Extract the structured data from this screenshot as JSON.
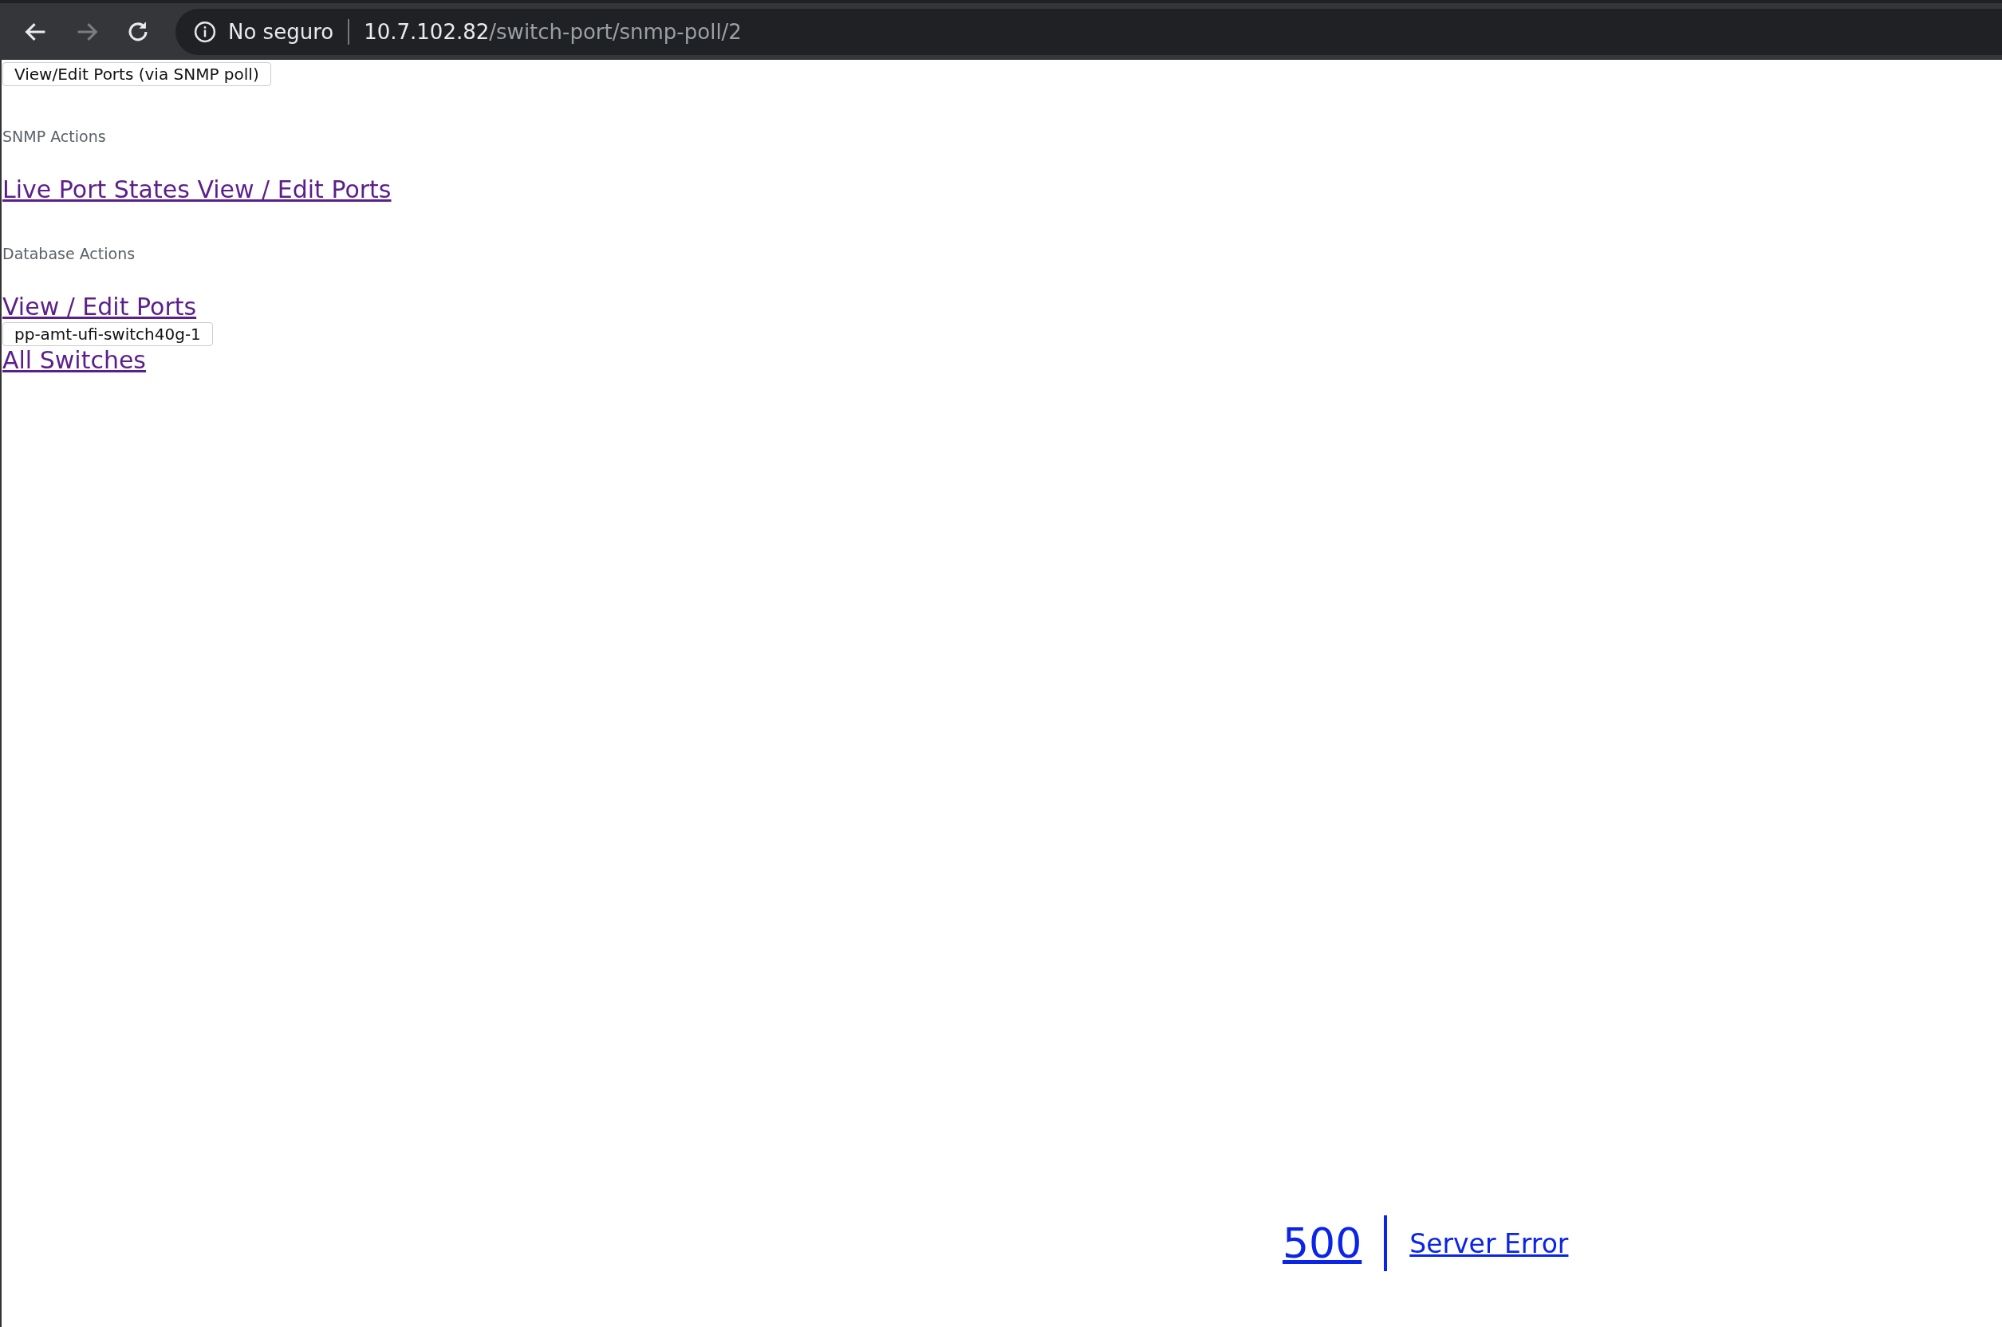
{
  "browser": {
    "back_disabled": false,
    "forward_disabled": true,
    "security_label": "No seguro",
    "url_host": "10.7.102.82",
    "url_path": "/switch-port/snmp-poll/2"
  },
  "page": {
    "top_button": "View/Edit Ports (via SNMP poll)",
    "sections": [
      {
        "heading": "SNMP Actions",
        "link": "Live Port States View / Edit Ports"
      },
      {
        "heading": "Database Actions",
        "link": "View / Edit Ports"
      }
    ],
    "switch_button": "pp-amt-ufi-switch40g-1",
    "all_switches_link": "All Switches"
  },
  "error": {
    "code": "500",
    "message": "Server Error"
  }
}
